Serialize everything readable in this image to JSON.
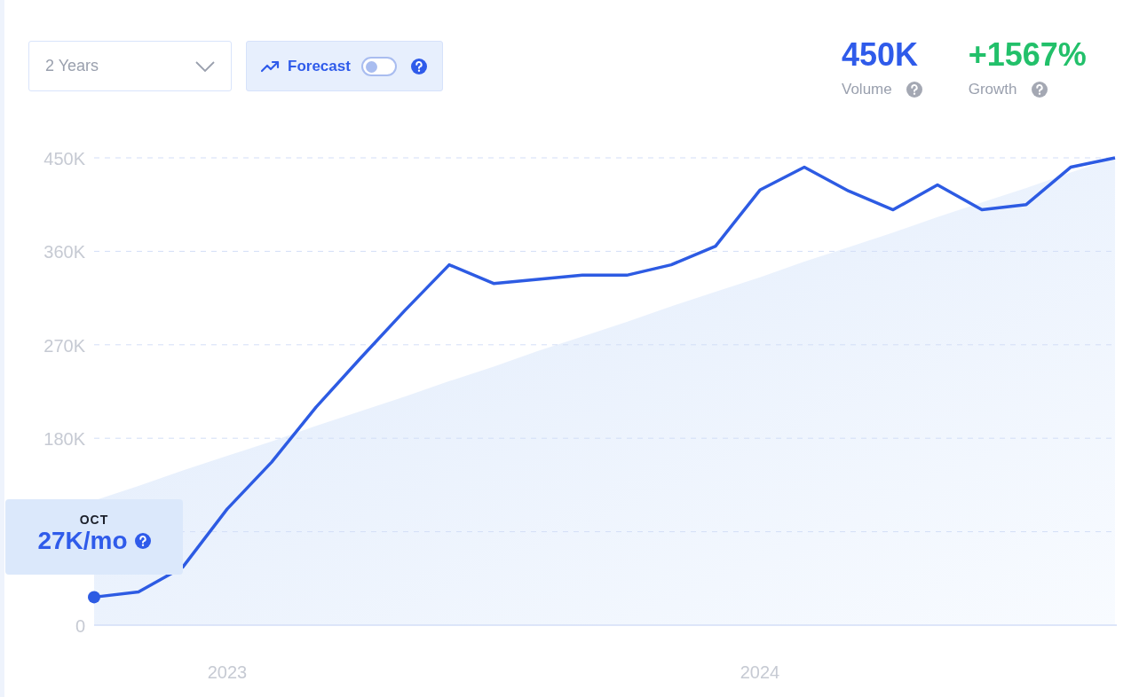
{
  "period_select": {
    "value": "2 Years"
  },
  "forecast": {
    "label": "Forecast",
    "on": false
  },
  "stats": [
    {
      "value": "450K",
      "label": "Volume",
      "color": "#2f5bea"
    },
    {
      "value": "+1567%",
      "label": "Growth",
      "color": "#22c06a"
    }
  ],
  "chart": {
    "tooltip": {
      "month": "OCT",
      "value": "27K/mo"
    },
    "chart_data": {
      "type": "line",
      "categories": [
        null,
        null,
        null,
        "2023",
        null,
        null,
        null,
        null,
        null,
        null,
        null,
        null,
        null,
        null,
        null,
        "2024",
        null,
        null,
        null,
        null,
        null,
        null,
        null,
        null
      ],
      "series": [
        {
          "type": "line",
          "color": "#2d5be3",
          "values": [
            27,
            32,
            56,
            112,
            157,
            210,
            257,
            303,
            347,
            329,
            333,
            337,
            337,
            347,
            365,
            419,
            441,
            418,
            400,
            424,
            400,
            405,
            441,
            450
          ]
        },
        {
          "type": "area",
          "color": "#dfeafb",
          "values": [
            120,
            134,
            149,
            163,
            177,
            192,
            206,
            220,
            235,
            249,
            264,
            278,
            292,
            307,
            321,
            335,
            350,
            364,
            378,
            393,
            407,
            421,
            436,
            450
          ]
        }
      ],
      "ylim": [
        0,
        450
      ],
      "grid": true,
      "yticks": [
        {
          "value": 0,
          "label": "0"
        },
        {
          "value": 180,
          "label": "180K"
        },
        {
          "value": 270,
          "label": "270K"
        },
        {
          "value": 360,
          "label": "360K"
        },
        {
          "value": 450,
          "label": "450K"
        }
      ]
    }
  }
}
